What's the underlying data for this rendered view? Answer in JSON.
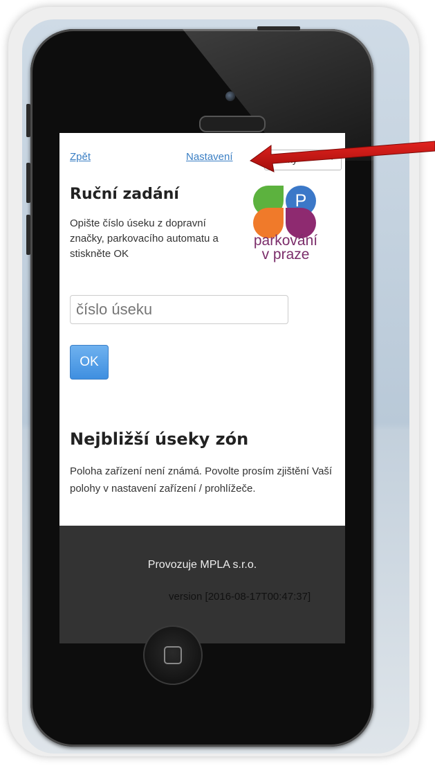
{
  "header": {
    "back_label": "Zpět",
    "settings_label": "Nastavení",
    "language_select_value": "Česky"
  },
  "manual_entry": {
    "title": "Ruční zadání",
    "instructions": "Opište číslo úseku z dopravní značky, parkovacího automatu a stiskněte OK",
    "input_placeholder": "číslo úseku",
    "ok_label": "OK"
  },
  "logo": {
    "text_line1": "parkování",
    "text_line2": "v praze",
    "letter": "P",
    "colors": {
      "green": "#5cb23e",
      "blue": "#3b78c8",
      "orange": "#f07a2a",
      "purple": "#8e2a70"
    }
  },
  "nearest": {
    "title": "Nejbližší úseky zón",
    "text": "Poloha zařízení není známá. Povolte prosím zjištění Vaší polohy v nastavení zařízení / prohlížeče."
  },
  "footer": {
    "operator": "Provozuje MPLA s.r.o.",
    "version": "version [2016-08-17T00:47:37]"
  },
  "annotation": {
    "arrow_color": "#c4120f"
  }
}
